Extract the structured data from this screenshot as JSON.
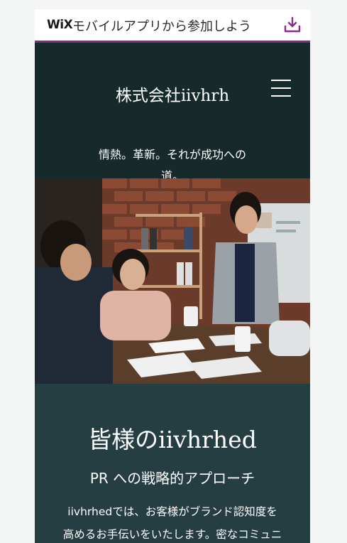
{
  "banner": {
    "logo": "WiX",
    "text": "モバイルアプリから参加しよう",
    "download_icon": "download-icon"
  },
  "header": {
    "site_title": "株式会社iivhrh",
    "tagline_line1": "情熱。革新。それが成功への",
    "tagline_line2": "道。",
    "menu_icon": "hamburger-menu-icon"
  },
  "hero": {
    "alt": "オフィス会議の写真"
  },
  "content": {
    "heading": "皆様のiivhrhed",
    "subheading": "PR への戦略的アプローチ",
    "body_line1": "iivhrhedでは、お客様がブランド認知度を",
    "body_line2": "高めるお手伝いをいたします。密なコミュニ"
  },
  "colors": {
    "banner_border": "#8a2a8e",
    "header_bg": "#16292b",
    "content_bg": "#253e42",
    "icon_accent": "#8a2a8e"
  }
}
